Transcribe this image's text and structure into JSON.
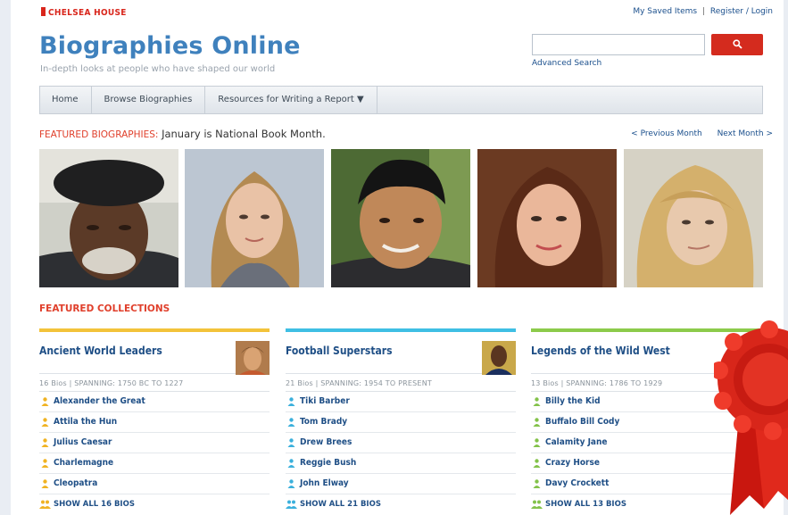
{
  "header": {
    "publisher": "CHELSEA HOUSE",
    "top_links": [
      "My Saved Items",
      "Register / Login"
    ],
    "title": "Biographies Online",
    "subtitle": "In-depth looks at people who have shaped our world"
  },
  "search": {
    "placeholder": "",
    "value": "",
    "advanced_link": "Advanced Search",
    "button_icon": "search-icon"
  },
  "nav": [
    {
      "label": "Home"
    },
    {
      "label": "Browse Biographies"
    },
    {
      "label": "Resources for Writing a Report ▼"
    }
  ],
  "featured": {
    "label": "FEATURED BIOGRAPHIES:",
    "heading": "January is National Book Month.",
    "prev": "< Previous Month",
    "next": "Next Month >"
  },
  "collections_heading": "FEATURED COLLECTIONS",
  "collections": [
    {
      "title": "Ancient World Leaders",
      "meta": "16 Bios | SPANNING: 1750 BC TO 1227",
      "accent": "#f3c33a",
      "icon_color": "#f0b323",
      "items": [
        "Alexander the Great",
        "Attila the Hun",
        "Julius Caesar",
        "Charlemagne",
        "Cleopatra"
      ],
      "show_all": "SHOW ALL 16 BIOS"
    },
    {
      "title": "Football Superstars",
      "meta": "21 Bios | SPANNING: 1954 TO PRESENT",
      "accent": "#3fbfe4",
      "icon_color": "#3bb0dc",
      "items": [
        "Tiki Barber",
        "Tom Brady",
        "Drew Brees",
        "Reggie Bush",
        "John Elway"
      ],
      "show_all": "SHOW ALL 21 BIOS"
    },
    {
      "title": "Legends of the Wild West",
      "meta": "13 Bios | SPANNING: 1786 TO 1929",
      "accent": "#8ccb4b",
      "icon_color": "#83c24a",
      "items": [
        "Billy the Kid",
        "Buffalo Bill Cody",
        "Calamity Jane",
        "Crazy Horse",
        "Davy Crockett"
      ],
      "show_all": "SHOW ALL 13 BIOS"
    }
  ],
  "colors": {
    "brand_blue": "#3f81bd",
    "link_blue": "#1f4f86",
    "accent_red": "#e0402c",
    "search_red": "#d42b1e"
  }
}
